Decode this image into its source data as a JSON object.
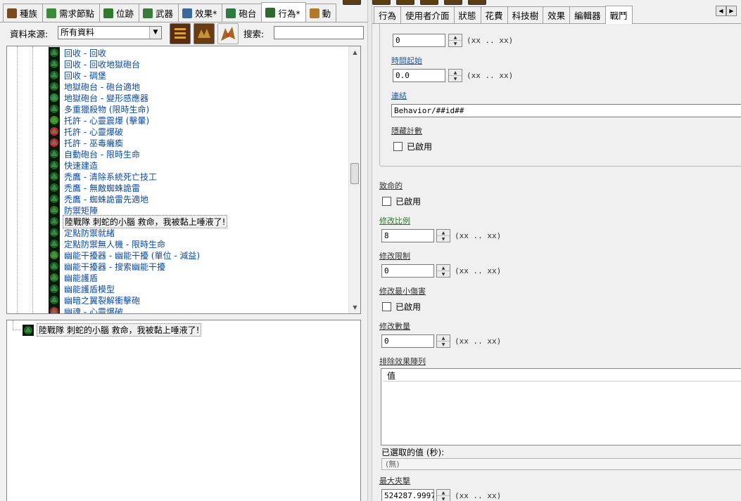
{
  "top_tabs": [
    {
      "label": "種族",
      "color": "#7a4a1e"
    },
    {
      "label": "需求節點",
      "color": "#3a8a3a"
    },
    {
      "label": "位跡",
      "color": "#2f7a2f"
    },
    {
      "label": "武器",
      "color": "#3a7a3a"
    },
    {
      "label": "效果*",
      "color": "#3a6a9a"
    },
    {
      "label": "砲台",
      "color": "#2e7a3e"
    },
    {
      "label": "行為*",
      "color": "#2e6a2e",
      "active": true
    },
    {
      "label": "動",
      "color": "#b07a2a"
    }
  ],
  "tab_scroll": {
    "left": "◀",
    "right": "▶"
  },
  "filter": {
    "source_label": "資料來源:",
    "source_value": "所有資料",
    "search_label": "搜索:",
    "search_value": ""
  },
  "list_items": [
    {
      "text": "回收 - 回收",
      "icon": "#1e5a2a"
    },
    {
      "text": "回收 - 回收地獄砲台",
      "icon": "#1e5a2a"
    },
    {
      "text": "回收 - 碉堡",
      "icon": "#1e5a2a"
    },
    {
      "text": "地獄砲台 - 砲台適地",
      "icon": "#1e5a2a"
    },
    {
      "text": "地獄砲台 - 變形感應器",
      "icon": "#2a7a3a"
    },
    {
      "text": "多重獵殺物 (限時生命)",
      "icon": "#1e5a2a"
    },
    {
      "text": "托許 - 心靈震爆 (擊暈)",
      "icon": "#3a8a2a"
    },
    {
      "text": "托許 - 心靈爆破",
      "icon": "#c0203a"
    },
    {
      "text": "托許 - 巫毒癱瘓",
      "icon": "#c0203a"
    },
    {
      "text": "自動砲台 - 限時生命",
      "icon": "#1e5a2a"
    },
    {
      "text": "快速建造",
      "icon": "#1e5a2a"
    },
    {
      "text": "禿鷹 - 清除系統死亡技工",
      "icon": "#1e5a2a"
    },
    {
      "text": "禿鷹 - 無敵蜘蛛詭雷",
      "icon": "#1e5a2a"
    },
    {
      "text": "禿鷹 - 蜘蛛詭雷先適地",
      "icon": "#1e5a2a"
    },
    {
      "text": "防禦矩陣",
      "icon": "#2a6a2a"
    },
    {
      "text": "陸戰隊 刺蛇的小腦 救命，我被黏上唾液了!",
      "icon": "#1e5a2a",
      "selected": true
    },
    {
      "text": "定點防禦就緒",
      "icon": "#1e5a2a"
    },
    {
      "text": "定點防禦無人機 - 限時生命",
      "icon": "#1e5a2a"
    },
    {
      "text": "幽能干擾器 - 幽能干擾 (單位 - 減益)",
      "icon": "#3a7a2a"
    },
    {
      "text": "幽能干擾器 - 搜索幽能干擾",
      "icon": "#1e5a2a"
    },
    {
      "text": "幽能護盾",
      "icon": "#2a6a2a"
    },
    {
      "text": "幽能護盾模型",
      "icon": "#1e5a2a"
    },
    {
      "text": "幽暗之翼裂解衝擊砲",
      "icon": "#1e5a2a"
    },
    {
      "text": "幽魂 - 心靈爆破",
      "icon": "#c0203a"
    }
  ],
  "list_scroll": {
    "up": "▲",
    "down": "▼"
  },
  "tree": {
    "text": "陸戰隊 刺蛇的小腦 救命，我被黏上唾液了!",
    "icon": "#1e5a2a"
  },
  "right_tabs": [
    {
      "label": "行為"
    },
    {
      "label": "使用者介面"
    },
    {
      "label": "狀態"
    },
    {
      "label": "花費"
    },
    {
      "label": "科技樹"
    },
    {
      "label": "效果"
    },
    {
      "label": "編輯器"
    },
    {
      "label": "戰鬥",
      "active": true
    }
  ],
  "fields": {
    "top_value": "0",
    "top_range": "(xx .. xx)",
    "time_start_label": "時間起始",
    "time_start_value": "0.0",
    "time_start_range": "(xx .. xx)",
    "link_label": "連結",
    "link_value": "Behavior/##id##",
    "hide_count_label": "隱藏計數",
    "hide_count_cb": "已啟用",
    "fatal_label": "致命的",
    "fatal_cb": "已啟用",
    "mod_ratio_label": "修改比例",
    "mod_ratio_value": "8",
    "mod_ratio_range": "(xx .. xx)",
    "mod_limit_label": "修改限制",
    "mod_limit_value": "0",
    "mod_limit_range": "(xx .. xx)",
    "mod_min_dmg_label": "修改最小傷害",
    "mod_min_dmg_cb": "已啟用",
    "mod_count_label": "修改數量",
    "mod_count_value": "0",
    "mod_count_range": "(xx .. xx)",
    "exclude_label": "排除效果陣列",
    "exclude_header": "值",
    "selected_label": "已選取的值 (秒):",
    "selected_value": "(無)",
    "max_clamp_label": "最大夾擊",
    "max_clamp_value": "524287.9997",
    "max_clamp_range": "(xx .. xx)"
  }
}
